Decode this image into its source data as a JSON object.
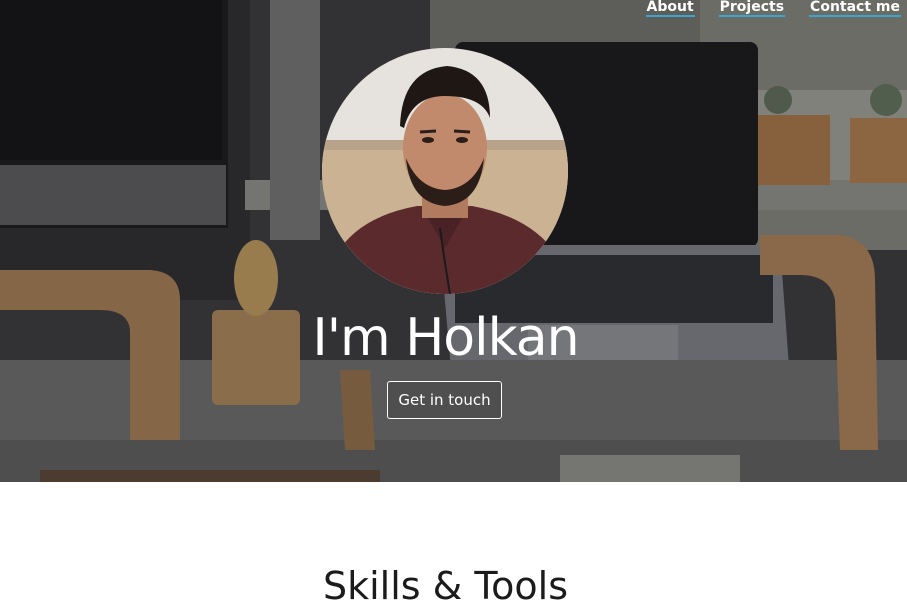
{
  "nav": {
    "items": [
      {
        "label": "About"
      },
      {
        "label": "Projects"
      },
      {
        "label": "Contact me"
      }
    ]
  },
  "hero": {
    "title": "I'm Holkan",
    "cta_label": "Get in touch",
    "avatar_icon": "profile-photo",
    "background_icon": "desk-workspace-photo"
  },
  "skills": {
    "heading": "Skills & Tools"
  },
  "colors": {
    "nav_underline": "#3fa4c9",
    "hero_text": "#ffffff",
    "page_bg": "#ffffff"
  }
}
